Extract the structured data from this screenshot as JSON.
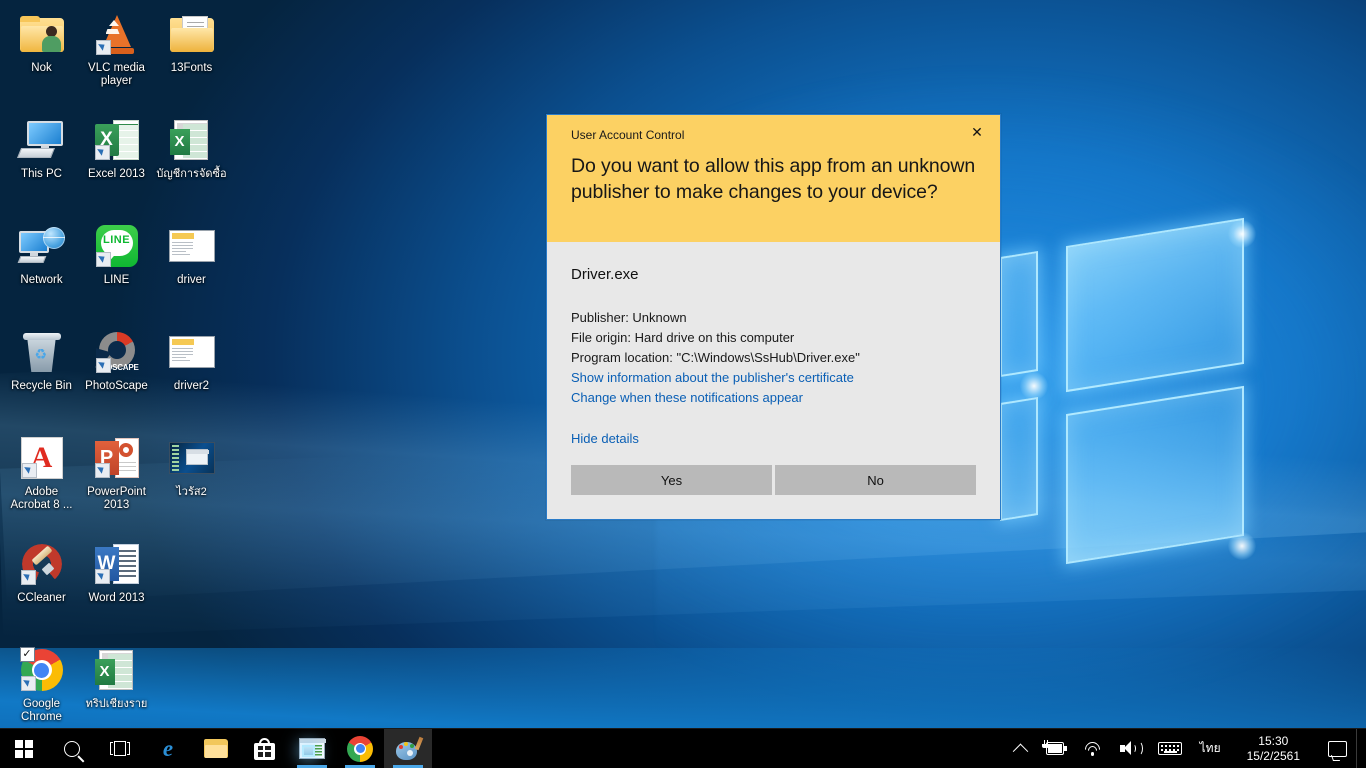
{
  "desktop": {
    "icons": [
      {
        "label": "Nok",
        "icon": "user-folder-icon",
        "shortcut": false
      },
      {
        "label": "VLC media player",
        "icon": "vlc-cone-icon",
        "shortcut": true
      },
      {
        "label": "13Fonts",
        "icon": "folder-documents-icon",
        "shortcut": false
      },
      {
        "label": "This PC",
        "icon": "this-pc-icon",
        "shortcut": false
      },
      {
        "label": "Excel 2013",
        "icon": "excel-icon",
        "shortcut": true
      },
      {
        "label": "บัญชีการจัดซื้อ",
        "icon": "excel-workbook-icon",
        "shortcut": false
      },
      {
        "label": "Network",
        "icon": "network-icon",
        "shortcut": false
      },
      {
        "label": "LINE",
        "icon": "line-app-icon",
        "shortcut": true
      },
      {
        "label": "driver",
        "icon": "screenshot-thumbnail-icon",
        "shortcut": false
      },
      {
        "label": "Recycle Bin",
        "icon": "recycle-bin-icon",
        "shortcut": false
      },
      {
        "label": "PhotoScape",
        "icon": "photoscape-icon",
        "shortcut": true
      },
      {
        "label": "driver2",
        "icon": "screenshot-thumbnail-icon",
        "shortcut": false
      },
      {
        "label": "Adobe Acrobat 8 ...",
        "icon": "adobe-acrobat-icon",
        "shortcut": true
      },
      {
        "label": "PowerPoint 2013",
        "icon": "powerpoint-icon",
        "shortcut": true
      },
      {
        "label": "ไวรัส2",
        "icon": "desktop-screenshot-icon",
        "shortcut": false
      },
      {
        "label": "CCleaner",
        "icon": "ccleaner-icon",
        "shortcut": true
      },
      {
        "label": "Word 2013",
        "icon": "word-icon",
        "shortcut": true
      },
      {
        "label": "",
        "icon": "empty",
        "shortcut": false
      },
      {
        "label": "Google Chrome",
        "icon": "chrome-icon",
        "shortcut": true,
        "checkbox": "✓"
      },
      {
        "label": "ทริปเชียงราย",
        "icon": "excel-workbook-icon",
        "shortcut": false
      }
    ]
  },
  "uac": {
    "title": "User Account Control",
    "close_label": "✕",
    "question": "Do you want to allow this app from an unknown publisher to make changes to your device?",
    "app_name": "Driver.exe",
    "publisher_line": "Publisher: Unknown",
    "file_origin_line": "File origin: Hard drive on this computer",
    "program_location_line": "Program location: \"C:\\Windows\\SsHub\\Driver.exe\"",
    "link_certificate": "Show information about the publisher's certificate",
    "link_notifications": "Change when these notifications appear",
    "link_hide_details": "Hide details",
    "button_yes": "Yes",
    "button_no": "No",
    "header_color": "#fcd163",
    "body_color": "#e8e8e8",
    "link_color": "#0a5fb5",
    "border_color": "#2a7bc8",
    "button_color": "#b9b9b9"
  },
  "taskbar": {
    "start_label": "start-button",
    "buttons": [
      {
        "name": "start-button",
        "icon": "windows-logo-icon",
        "running": false,
        "active": false
      },
      {
        "name": "search-button",
        "icon": "search-icon",
        "running": false,
        "active": false
      },
      {
        "name": "task-view-button",
        "icon": "task-view-icon",
        "running": false,
        "active": false
      },
      {
        "name": "edge-button",
        "icon": "edge-icon",
        "running": false,
        "active": false
      },
      {
        "name": "file-explorer-button",
        "icon": "folder-icon",
        "running": false,
        "active": false
      },
      {
        "name": "microsoft-store-button",
        "icon": "store-bag-icon",
        "running": false,
        "active": false
      },
      {
        "name": "app-window-button",
        "icon": "app-window-icon",
        "running": true,
        "active": false
      },
      {
        "name": "chrome-button",
        "icon": "chrome-icon",
        "running": true,
        "active": false
      },
      {
        "name": "paint-button",
        "icon": "paint-palette-icon",
        "running": true,
        "active": true
      }
    ],
    "tray": {
      "overflow_icon": "chevron-up-icon",
      "battery_icon": "battery-charging-icon",
      "wifi_icon": "wifi-icon",
      "volume_icon": "speaker-icon",
      "keyboard_icon": "keyboard-icon",
      "language": "ไทย",
      "time": "15:30",
      "date": "15/2/2561",
      "action_center_icon": "action-center-icon"
    }
  }
}
